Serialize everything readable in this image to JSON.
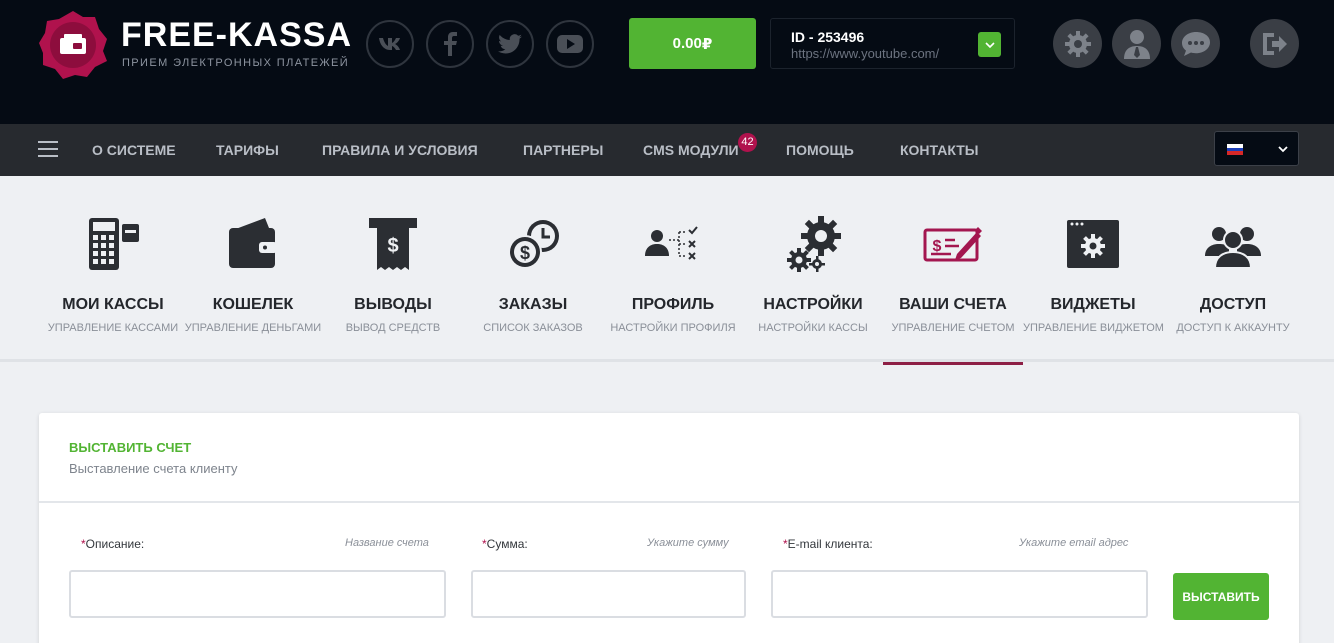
{
  "brand": {
    "name": "FREE-KASSA",
    "tagline": "ПРИЕМ ЭЛЕКТРОННЫХ ПЛАТЕЖЕЙ",
    "accent": "#b0124d"
  },
  "social": [
    {
      "icon": "vk-icon"
    },
    {
      "icon": "facebook-icon"
    },
    {
      "icon": "twitter-icon"
    },
    {
      "icon": "youtube-icon"
    }
  ],
  "balance": {
    "value": "0.00",
    "currency": "₽",
    "color": "#52b433"
  },
  "account": {
    "id_label": "ID - 253496",
    "site": "https://www.youtube.com/"
  },
  "header_actions": [
    {
      "icon": "gear-icon"
    },
    {
      "icon": "user-icon"
    },
    {
      "icon": "chat-icon"
    },
    {
      "icon": "logout-icon"
    }
  ],
  "menu": {
    "items": [
      {
        "label": "О СИСТЕМЕ"
      },
      {
        "label": "ТАРИФЫ"
      },
      {
        "label": "ПРАВИЛА И УСЛОВИЯ"
      },
      {
        "label": "ПАРТНЕРЫ"
      },
      {
        "label": "CMS МОДУЛИ",
        "badge": "42"
      },
      {
        "label": "ПОМОЩЬ"
      },
      {
        "label": "КОНТАКТЫ"
      }
    ],
    "language": "ru"
  },
  "sections": [
    {
      "title": "МОИ КАССЫ",
      "subtitle": "УПРАВЛЕНИЕ КАССАМИ",
      "icon": "cash-register-icon"
    },
    {
      "title": "КОШЕЛЕК",
      "subtitle": "УПРАВЛЕНИЕ ДЕНЬГАМИ",
      "icon": "wallet-icon"
    },
    {
      "title": "ВЫВОДЫ",
      "subtitle": "ВЫВОД СРЕДСТВ",
      "icon": "receipt-icon"
    },
    {
      "title": "ЗАКАЗЫ",
      "subtitle": "СПИСОК ЗАКАЗОВ",
      "icon": "coins-clock-icon"
    },
    {
      "title": "ПРОФИЛЬ",
      "subtitle": "НАСТРОЙКИ ПРОФИЛЯ",
      "icon": "profile-checklist-icon"
    },
    {
      "title": "НАСТРОЙКИ",
      "subtitle": "НАСТРОЙКИ КАССЫ",
      "icon": "gears-icon"
    },
    {
      "title": "ВАШИ СЧЕТА",
      "subtitle": "УПРАВЛЕНИЕ СЧЕТОМ",
      "icon": "check-pen-icon",
      "active": true
    },
    {
      "title": "ВИДЖЕТЫ",
      "subtitle": "УПРАВЛЕНИЕ ВИДЖЕТОМ",
      "icon": "widget-window-icon"
    },
    {
      "title": "ДОСТУП",
      "subtitle": "ДОСТУП К АККАУНТУ",
      "icon": "users-group-icon"
    }
  ],
  "invoice": {
    "title": "ВЫСТАВИТЬ СЧЕТ",
    "subtitle": "Выставление счета клиенту",
    "fields": [
      {
        "label": "Описание:",
        "hint": "Название счета",
        "value": ""
      },
      {
        "label": "Сумма:",
        "hint": "Укажите сумму",
        "value": ""
      },
      {
        "label": "E-mail клиента:",
        "hint": "Укажите email адрес",
        "value": ""
      }
    ],
    "required_mark": "*",
    "submit_label": "ВЫСТАВИТЬ"
  }
}
